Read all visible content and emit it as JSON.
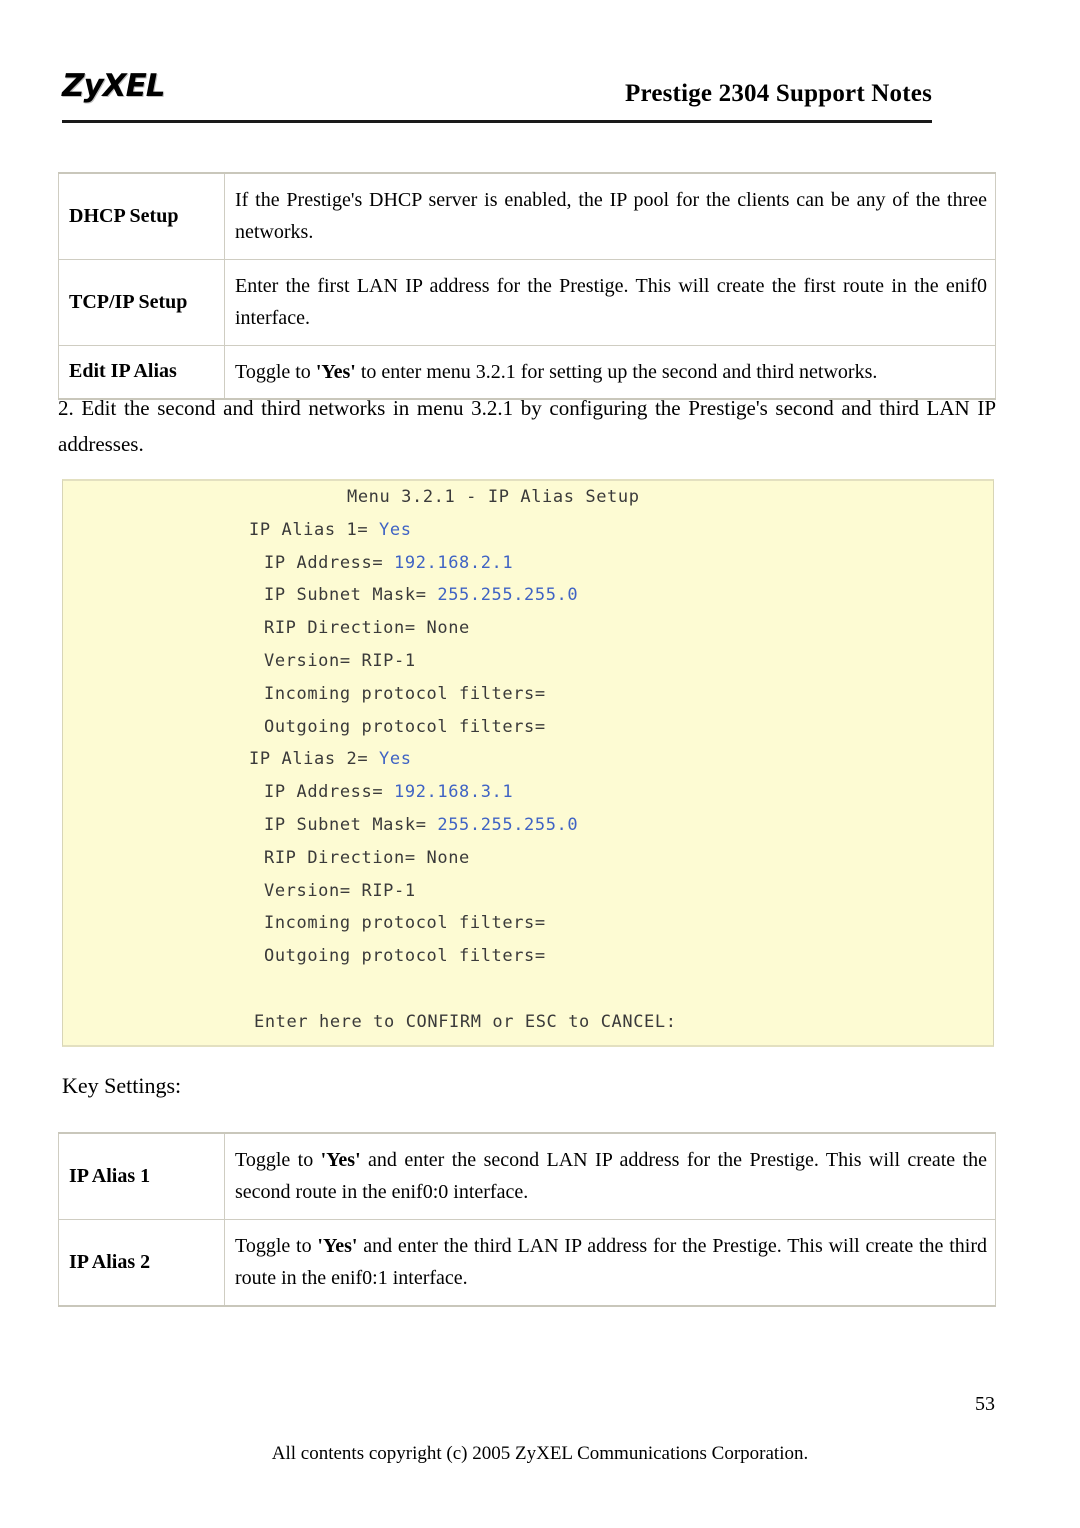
{
  "header": {
    "logo": "ZyXEL",
    "title": "Prestige 2304 Support Notes"
  },
  "table_top": {
    "rows": [
      {
        "key": "DHCP Setup",
        "value": "If the Prestige's DHCP server is enabled, the IP pool for the clients can be any of the three networks."
      },
      {
        "key": "TCP/IP Setup",
        "value": "Enter the first LAN IP address for the Prestige. This will create the first route in the enif0 interface."
      },
      {
        "key": "Edit IP Alias",
        "value_pre": "Toggle to ",
        "value_bold": "'Yes'",
        "value_post": " to enter menu 3.2.1 for setting up the second and third networks."
      }
    ]
  },
  "paragraph": "2. Edit the second and third networks in menu 3.2.1 by configuring the Prestige's second and third LAN IP addresses.",
  "console": {
    "title": "Menu 3.2.1 - IP Alias Setup",
    "lines": [
      {
        "label": "IP Alias 1=",
        "value": "Yes",
        "indent": 0
      },
      {
        "label": "IP Address=",
        "value": "192.168.2.1",
        "indent": 1
      },
      {
        "label": "IP Subnet Mask=",
        "value": "255.255.255.0",
        "indent": 1
      },
      {
        "label": "RIP Direction= None",
        "value": "",
        "indent": 1
      },
      {
        "label": "Version= RIP-1",
        "value": "",
        "indent": 1
      },
      {
        "label": "Incoming protocol filters=",
        "value": "",
        "indent": 1
      },
      {
        "label": "Outgoing protocol filters=",
        "value": "",
        "indent": 1
      },
      {
        "label": "IP Alias 2=",
        "value": "Yes",
        "indent": 0
      },
      {
        "label": "IP Address=",
        "value": "192.168.3.1",
        "indent": 1
      },
      {
        "label": "IP Subnet Mask=",
        "value": "255.255.255.0",
        "indent": 1
      },
      {
        "label": "RIP Direction= None",
        "value": "",
        "indent": 1
      },
      {
        "label": "Version= RIP-1",
        "value": "",
        "indent": 1
      },
      {
        "label": "Incoming protocol filters=",
        "value": "",
        "indent": 1
      },
      {
        "label": "Outgoing protocol filters=",
        "value": "",
        "indent": 1
      }
    ],
    "prompt": "Enter here to CONFIRM or ESC to CANCEL:",
    "colors": {
      "background": "#fdfbd3",
      "text": "#3a3a3a",
      "value": "#3f63c4"
    }
  },
  "key_settings_caption": "Key Settings:",
  "table_bottom": {
    "rows": [
      {
        "key": "IP Alias 1",
        "value_pre": "Toggle to ",
        "value_bold": "'Yes'",
        "value_post": " and enter the second LAN IP address for the Prestige. This will create the second route in the enif0:0 interface."
      },
      {
        "key": "IP Alias 2",
        "value_pre": "Toggle to ",
        "value_bold": "'Yes'",
        "value_post": " and enter the third LAN IP address for the Prestige. This will create the third route in the enif0:1 interface."
      }
    ]
  },
  "footer": {
    "page_number": "53",
    "copyright": "All contents copyright (c) 2005 ZyXEL Communications Corporation."
  }
}
